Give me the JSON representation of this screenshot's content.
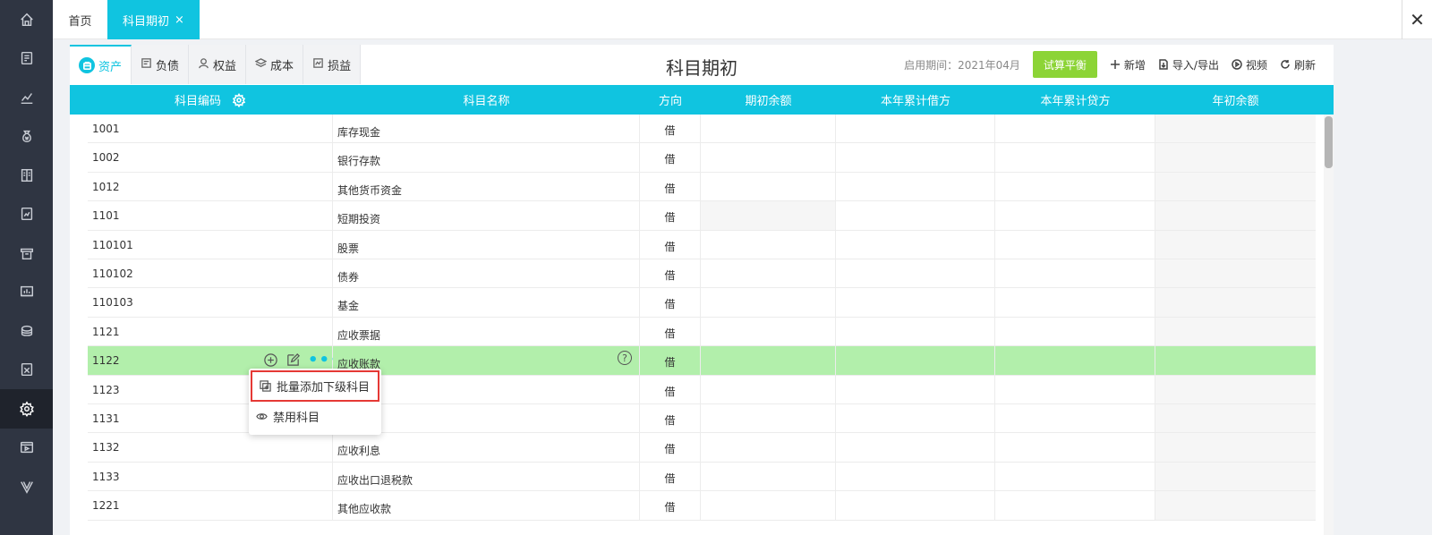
{
  "sidebar": {
    "icons": [
      "home-icon",
      "voucher-icon",
      "report-chart-icon",
      "money-bag-icon",
      "ledger-book-icon",
      "invoice-icon",
      "inventory-icon",
      "fixed-asset-icon",
      "salary-icon",
      "export-icon",
      "settings-icon",
      "video-icon",
      "v-logo-icon"
    ],
    "active": "settings-icon"
  },
  "topbar": {
    "home_tab": "首页",
    "current_tab": "科目期初",
    "close_symbol": "×",
    "window_close": "✕"
  },
  "category_tabs": [
    {
      "label": "资产",
      "icon": "asset-icon",
      "active": true
    },
    {
      "label": "负债",
      "icon": "liability-icon",
      "active": false
    },
    {
      "label": "权益",
      "icon": "equity-icon",
      "active": false
    },
    {
      "label": "成本",
      "icon": "cost-icon",
      "active": false
    },
    {
      "label": "损益",
      "icon": "profit-loss-icon",
      "active": false
    }
  ],
  "page_title": "科目期初",
  "toolbar": {
    "period_label": "启用期间：2021年04月",
    "trial_balance": "试算平衡",
    "add": "新增",
    "import_export": "导入/导出",
    "video": "视频",
    "refresh": "刷新"
  },
  "table": {
    "columns": [
      "科目编码",
      "科目名称",
      "方向",
      "期初余额",
      "本年累计借方",
      "本年累计贷方",
      "年初余额"
    ],
    "rows": [
      {
        "code": "1001",
        "name": "库存现金",
        "dir": "借"
      },
      {
        "code": "1002",
        "name": "银行存款",
        "dir": "借"
      },
      {
        "code": "1012",
        "name": "其他货币资金",
        "dir": "借"
      },
      {
        "code": "1101",
        "name": "短期投资",
        "dir": "借"
      },
      {
        "code": "110101",
        "name": "股票",
        "dir": "借"
      },
      {
        "code": "110102",
        "name": "债券",
        "dir": "借"
      },
      {
        "code": "110103",
        "name": "基金",
        "dir": "借"
      },
      {
        "code": "1121",
        "name": "应收票据",
        "dir": "借"
      },
      {
        "code": "1122",
        "name": "应收账款",
        "dir": "借"
      },
      {
        "code": "1123",
        "name": "",
        "dir": "借"
      },
      {
        "code": "1131",
        "name": "",
        "dir": "借"
      },
      {
        "code": "1132",
        "name": "应收利息",
        "dir": "借"
      },
      {
        "code": "1133",
        "name": "应收出口退税款",
        "dir": "借"
      },
      {
        "code": "1221",
        "name": "其他应收款",
        "dir": "借"
      }
    ],
    "highlight_row": 8,
    "grey_opening_row": 3
  },
  "row_menu": {
    "items": [
      "批量添加下级科目",
      "禁用科目"
    ]
  },
  "colors": {
    "accent": "#10c4e0",
    "highlight_row": "#b2efab",
    "green_button": "#8cd436",
    "sidebar": "#2f3542",
    "menu_border": "#e53935"
  }
}
